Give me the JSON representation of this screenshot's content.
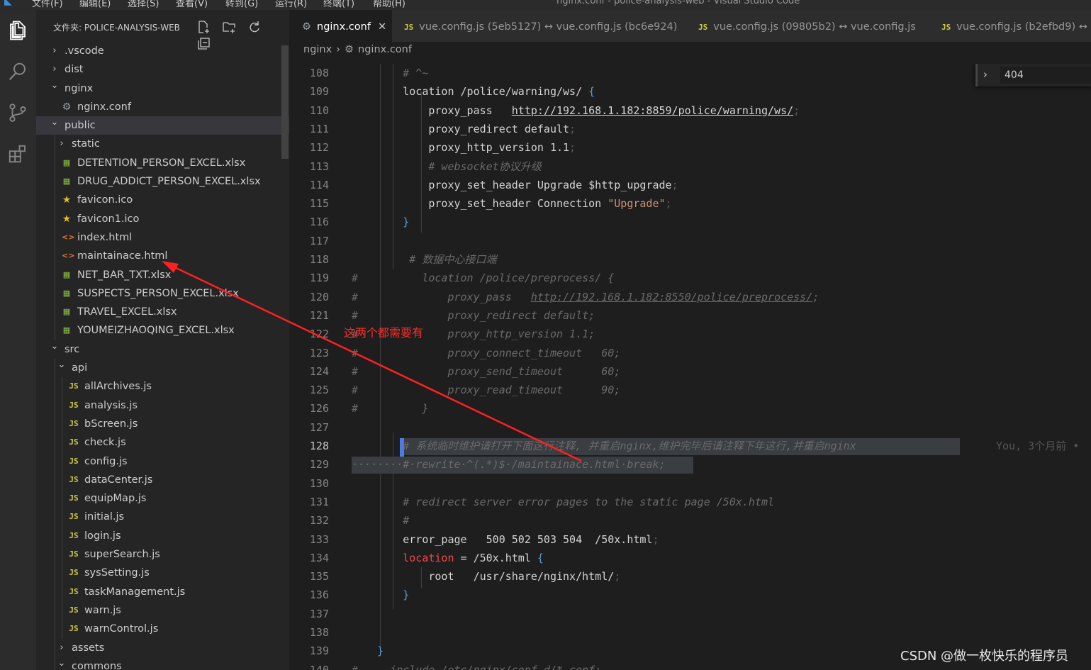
{
  "menubar": {
    "items": [
      "文件(F)",
      "编辑(E)",
      "选择(S)",
      "查看(V)",
      "转到(G)",
      "运行(R)",
      "终端(T)",
      "帮助(H)"
    ],
    "window_title": "nginx.conf - police-analysis-web - Visual Studio Code"
  },
  "activity_bar": {
    "icons": [
      "explorer-icon",
      "search-icon",
      "source-control-icon",
      "extensions-icon"
    ]
  },
  "explorer": {
    "header": "文件夹: POLICE-ANALYSIS-WEB",
    "action_icons": [
      "new-file-icon",
      "new-folder-icon",
      "refresh-icon",
      "collapse-all-icon"
    ],
    "tree": [
      {
        "label": ".vscode",
        "type": "folder",
        "expanded": false,
        "depth": 0
      },
      {
        "label": "dist",
        "type": "folder",
        "expanded": false,
        "depth": 0
      },
      {
        "label": "nginx",
        "type": "folder",
        "expanded": true,
        "depth": 0
      },
      {
        "label": "nginx.conf",
        "type": "gear",
        "depth": 1
      },
      {
        "label": "public",
        "type": "folder",
        "expanded": true,
        "depth": 0,
        "selected": true
      },
      {
        "label": "static",
        "type": "folder",
        "expanded": false,
        "depth": 1
      },
      {
        "label": "DETENTION_PERSON_EXCEL.xlsx",
        "type": "excel",
        "depth": 1
      },
      {
        "label": "DRUG_ADDICT_PERSON_EXCEL.xlsx",
        "type": "excel",
        "depth": 1
      },
      {
        "label": "favicon.ico",
        "type": "star",
        "depth": 1
      },
      {
        "label": "favicon1.ico",
        "type": "star",
        "depth": 1
      },
      {
        "label": "index.html",
        "type": "html",
        "depth": 1
      },
      {
        "label": "maintainace.html",
        "type": "html",
        "depth": 1
      },
      {
        "label": "NET_BAR_TXT.xlsx",
        "type": "excel",
        "depth": 1
      },
      {
        "label": "SUSPECTS_PERSON_EXCEL.xlsx",
        "type": "excel",
        "depth": 1
      },
      {
        "label": "TRAVEL_EXCEL.xlsx",
        "type": "excel",
        "depth": 1
      },
      {
        "label": "YOUMEIZHAOQING_EXCEL.xlsx",
        "type": "excel",
        "depth": 1
      },
      {
        "label": "src",
        "type": "folder",
        "expanded": true,
        "depth": 0
      },
      {
        "label": "api",
        "type": "folder",
        "expanded": true,
        "depth": 1
      },
      {
        "label": "allArchives.js",
        "type": "js",
        "depth": 2
      },
      {
        "label": "analysis.js",
        "type": "js",
        "depth": 2
      },
      {
        "label": "bScreen.js",
        "type": "js",
        "depth": 2
      },
      {
        "label": "check.js",
        "type": "js",
        "depth": 2
      },
      {
        "label": "config.js",
        "type": "js",
        "depth": 2
      },
      {
        "label": "dataCenter.js",
        "type": "js",
        "depth": 2
      },
      {
        "label": "equipMap.js",
        "type": "js",
        "depth": 2
      },
      {
        "label": "initial.js",
        "type": "js",
        "depth": 2
      },
      {
        "label": "login.js",
        "type": "js",
        "depth": 2
      },
      {
        "label": "superSearch.js",
        "type": "js",
        "depth": 2
      },
      {
        "label": "sysSetting.js",
        "type": "js",
        "depth": 2
      },
      {
        "label": "taskManagement.js",
        "type": "js",
        "depth": 2
      },
      {
        "label": "warn.js",
        "type": "js",
        "depth": 2
      },
      {
        "label": "warnControl.js",
        "type": "js",
        "depth": 2
      },
      {
        "label": "assets",
        "type": "folder",
        "expanded": false,
        "depth": 1
      },
      {
        "label": "commons",
        "type": "folder",
        "expanded": true,
        "depth": 1
      }
    ]
  },
  "tabs": [
    {
      "label": "nginx.conf",
      "icon": "gear-icon",
      "active": true,
      "close": "✕"
    },
    {
      "label": "vue.config.js (5eb5127) ↔ vue.config.js (bc6e924)",
      "icon": "JS",
      "active": false
    },
    {
      "label": "vue.config.js (09805b2) ↔ vue.config.js",
      "icon": "JS",
      "active": false
    },
    {
      "label": "vue.config.js (b2efbd9) ↔ v",
      "icon": "JS",
      "active": false
    }
  ],
  "breadcrumb": {
    "folder": "nginx",
    "file": "nginx.conf"
  },
  "find_widget": {
    "value": "404"
  },
  "editor": {
    "current_line": 128,
    "blame": "You, 3个月前 •",
    "lines": [
      {
        "n": 108,
        "segs": [
          [
            "cmt",
            "        # ^~"
          ]
        ]
      },
      {
        "n": 109,
        "segs": [
          [
            "kw",
            "        location /police/warning/ws/ "
          ],
          [
            "brace",
            "{"
          ]
        ]
      },
      {
        "n": 110,
        "segs": [
          [
            "kw",
            "            proxy_pass   "
          ],
          [
            "url",
            "http://192.168.1.182:8859/police/warning/ws/"
          ],
          [
            "semi",
            ";"
          ]
        ]
      },
      {
        "n": 111,
        "segs": [
          [
            "kw",
            "            proxy_redirect default"
          ],
          [
            "semi",
            ";"
          ]
        ]
      },
      {
        "n": 112,
        "segs": [
          [
            "kw",
            "            proxy_http_version 1.1"
          ],
          [
            "semi",
            ";"
          ]
        ]
      },
      {
        "n": 113,
        "segs": [
          [
            "cmt",
            "            # websocket协议升级"
          ]
        ]
      },
      {
        "n": 114,
        "segs": [
          [
            "kw",
            "            proxy_set_header Upgrade $http_upgrade"
          ],
          [
            "semi",
            ";"
          ]
        ]
      },
      {
        "n": 115,
        "segs": [
          [
            "kw",
            "            proxy_set_header Connection "
          ],
          [
            "str",
            "\"Upgrade\""
          ],
          [
            "semi",
            ";"
          ]
        ]
      },
      {
        "n": 116,
        "segs": [
          [
            "brace",
            "        }"
          ]
        ]
      },
      {
        "n": 117,
        "segs": []
      },
      {
        "n": 118,
        "segs": [
          [
            "cmt",
            "         # 数据中心接口端"
          ]
        ]
      },
      {
        "n": 119,
        "segs": [
          [
            "cmt",
            "#          location /police/preprocess/ {"
          ]
        ]
      },
      {
        "n": 120,
        "segs": [
          [
            "cmt",
            "#              proxy_pass   "
          ],
          [
            "cmtu",
            "http://192.168.1.182:8550/police/preprocess/"
          ],
          [
            "cmt",
            ";"
          ]
        ]
      },
      {
        "n": 121,
        "segs": [
          [
            "cmt",
            "#              proxy_redirect default;"
          ]
        ]
      },
      {
        "n": 122,
        "segs": [
          [
            "cmt",
            "#              proxy_http_version 1.1;"
          ]
        ]
      },
      {
        "n": 123,
        "segs": [
          [
            "cmt",
            "#              proxy_connect_timeout   60;"
          ]
        ]
      },
      {
        "n": 124,
        "segs": [
          [
            "cmt",
            "#              proxy_send_timeout      60;"
          ]
        ]
      },
      {
        "n": 125,
        "segs": [
          [
            "cmt",
            "#              proxy_read_timeout      90;"
          ]
        ]
      },
      {
        "n": 126,
        "segs": [
          [
            "cmt",
            "#          }"
          ]
        ]
      },
      {
        "n": 127,
        "segs": []
      },
      {
        "n": 128,
        "segs": [
          [
            "cmt",
            "        # 系统临时维护请打开下面这行注释, 并重启nginx,维护完毕后请注释下年这行,并重启nginx"
          ]
        ]
      },
      {
        "n": 129,
        "segs": [
          [
            "cmt",
            "········#·rewrite·^(.*)$·/maintainace.html·break;"
          ]
        ]
      },
      {
        "n": 130,
        "segs": []
      },
      {
        "n": 131,
        "segs": [
          [
            "cmt",
            "        # redirect server error pages to the static page /50x.html"
          ]
        ]
      },
      {
        "n": 132,
        "segs": [
          [
            "cmt",
            "        #"
          ]
        ]
      },
      {
        "n": 133,
        "segs": [
          [
            "kw",
            "        error_page   500 502 503 504  /50x.html"
          ],
          [
            "semi",
            ";"
          ]
        ]
      },
      {
        "n": 134,
        "segs": [
          [
            "red",
            "        location"
          ],
          [
            "kw",
            " = /50x.html "
          ],
          [
            "brace",
            "{"
          ]
        ]
      },
      {
        "n": 135,
        "segs": [
          [
            "kw",
            "            root   /usr/share/nginx/html/"
          ],
          [
            "semi",
            ";"
          ]
        ]
      },
      {
        "n": 136,
        "segs": [
          [
            "brace",
            "        }"
          ]
        ]
      },
      {
        "n": 137,
        "segs": []
      },
      {
        "n": 138,
        "segs": []
      },
      {
        "n": 139,
        "segs": [
          [
            "brace",
            "    }"
          ]
        ]
      },
      {
        "n": 140,
        "segs": [
          [
            "cmt",
            "#     include /etc/nginx/conf.d/*.conf;"
          ]
        ]
      }
    ]
  },
  "annotation": {
    "text": "这两个都需要有"
  },
  "watermark": {
    "text": "CSDN @做一枚快乐的程序员"
  }
}
